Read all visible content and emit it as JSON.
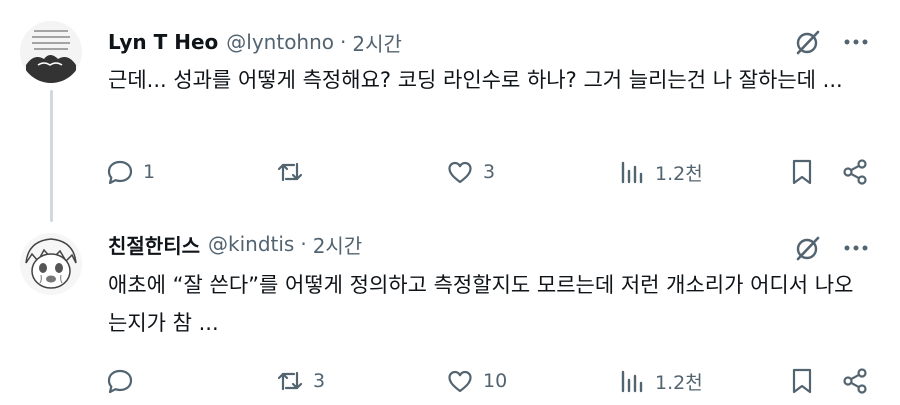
{
  "posts": [
    {
      "name": "Lyn T Heo",
      "handle": "@lyntohno",
      "separator": "·",
      "time": "2시간",
      "text": "근데... 성과를 어떻게 측정해요? 코딩 라인수로 하나? 그거 늘리는건 나 잘하는데 ...",
      "replies": "1",
      "reposts": "",
      "likes": "3",
      "views": "1.2천"
    },
    {
      "name": "친절한티스",
      "handle": "@kindtis",
      "separator": "·",
      "time": "2시간",
      "text": "애초에 “잘 쓴다”를 어떻게 정의하고 측정할지도 모르는데 저런 개소리가 어디서 나오는지가 참 ...",
      "replies": "",
      "reposts": "3",
      "likes": "10",
      "views": "1.2천"
    }
  ],
  "icons": {
    "reply": "reply-icon",
    "repost": "repost-icon",
    "like": "heart-icon",
    "views": "views-icon",
    "bookmark": "bookmark-icon",
    "share": "share-icon",
    "grok": "grok-icon",
    "more": "more-icon"
  },
  "colors": {
    "text": "#0f1419",
    "muted": "#536471",
    "thread_line": "#cfd9de",
    "background": "#ffffff"
  }
}
